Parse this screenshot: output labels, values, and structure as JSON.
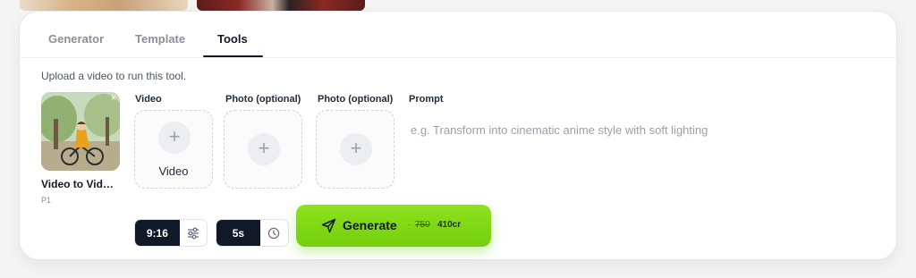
{
  "tabs": [
    {
      "label": "Generator"
    },
    {
      "label": "Template"
    },
    {
      "label": "Tools",
      "active": true
    }
  ],
  "hint": "Upload a video to run this tool.",
  "tool": {
    "title": "Video to Vid…",
    "subtitle": "P1",
    "close_icon": "×"
  },
  "slots": [
    {
      "label": "Video",
      "button_text": "Video",
      "icon": "plus-icon"
    },
    {
      "label": "Photo (optional)",
      "icon": "plus-icon"
    },
    {
      "label": "Photo (optional)",
      "icon": "plus-icon"
    }
  ],
  "prompt": {
    "label": "Prompt",
    "placeholder": "e.g. Transform into cinematic anime style with soft lighting",
    "value": ""
  },
  "controls": {
    "aspect_ratio": "9:16",
    "duration": "5s"
  },
  "generate": {
    "label": "Generate",
    "separator": "·",
    "old_price": "750",
    "new_price": "410cr"
  },
  "colors": {
    "accent": "#7ed321",
    "dark": "#111827"
  }
}
